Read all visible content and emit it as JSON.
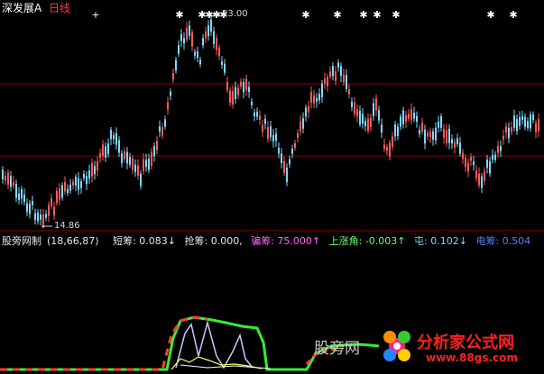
{
  "header": {
    "stock_name": "深发展A",
    "period": "日线"
  },
  "price_labels": {
    "high": "23.00",
    "low": "14.86"
  },
  "indicator": {
    "name": "股旁网制",
    "params": "(18,66,87)",
    "short_chip": "短筹: 0.083↓",
    "grab_chip": "抢筹: 0.000,",
    "lure_chip": "骗筹: 75.000↑",
    "rise_angle": "上涨角: -0.003↑",
    "hold": "屯: 0.102↓",
    "power": "电筹: 0.504"
  },
  "watermark": {
    "text": "股旁网"
  },
  "logo": {
    "name": "分析家公式网",
    "url": "www.88gs.com"
  },
  "colors": {
    "background": "#000000",
    "up_candle": "#ff5a5a",
    "down_candle": "#7fd8ff",
    "grid_line": "#8b0000",
    "star": "#ffffff",
    "line_green": "#33ee33",
    "line_red": "#ff3b3b",
    "line_lavender": "#c8c8ff",
    "line_yellow": "#ffff66"
  }
}
